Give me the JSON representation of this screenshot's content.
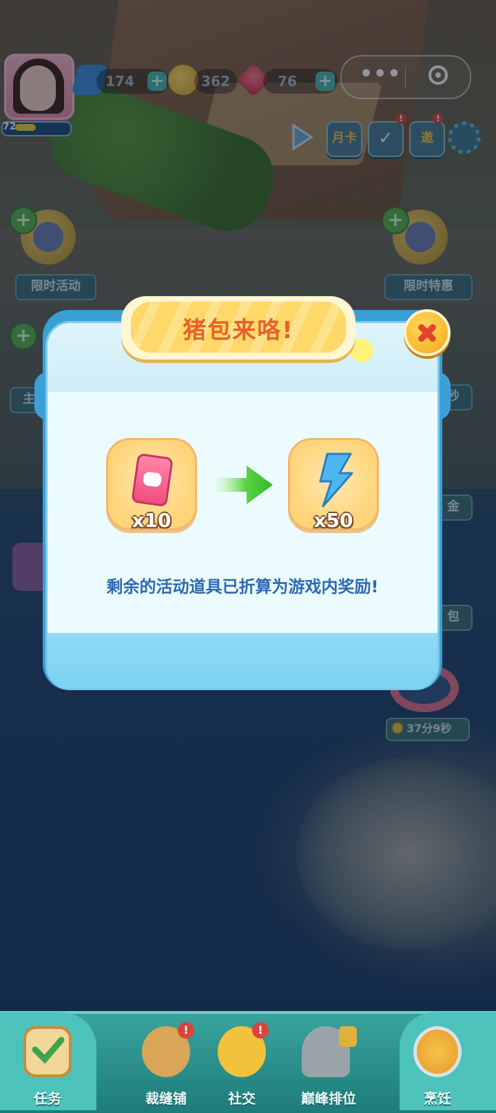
{
  "hud": {
    "level": "72",
    "energy": "174",
    "coins": "362",
    "gems": "76",
    "plus": "+",
    "month_card": "月卡",
    "invite": "邀",
    "badge": "!"
  },
  "side_left": {
    "limited_event": "限时活动",
    "theme": "主题"
  },
  "side_right": {
    "limited_offer": "限时特惠",
    "sec_partial": "秒",
    "gold_partial": "金",
    "pack_partial": "包",
    "timer": "37分9秒"
  },
  "dialog": {
    "title": "猪包来咯!",
    "from_qty": "x10",
    "to_qty": "x50",
    "message": "剩余的活动道具已折算为游戏内奖励!"
  },
  "nav": {
    "items": [
      {
        "label": "任务"
      },
      {
        "label": "裁缝铺"
      },
      {
        "label": "社交"
      },
      {
        "label": "巅峰排位"
      },
      {
        "label": "烹饪"
      }
    ]
  },
  "colors": {
    "title_text": "#e8612a",
    "message_text": "#2d69b1",
    "dialog_border": "#7cc9ef",
    "nav_bg": "#2a928e"
  }
}
